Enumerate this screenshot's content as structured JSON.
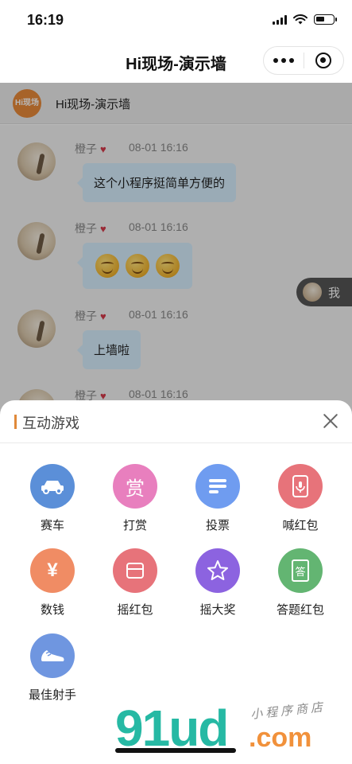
{
  "status_bar": {
    "time": "16:19"
  },
  "nav": {
    "title": "Hi现场-演示墙"
  },
  "page": {
    "logo_text": "Hi现场",
    "header_title": "Hi现场-演示墙",
    "me_label": "我",
    "messages": [
      {
        "sender": "橙子",
        "time": "08-01 16:16",
        "text": "这个小程序挺简单方便的"
      },
      {
        "sender": "橙子",
        "time": "08-01 16:16",
        "emoji_count": 3
      },
      {
        "sender": "橙子",
        "time": "08-01 16:16",
        "text": "上墙啦"
      },
      {
        "sender": "橙子",
        "time": "08-01 16:16"
      }
    ]
  },
  "sheet": {
    "title": "互动游戏",
    "games": [
      {
        "label": "赛车",
        "icon": "car-icon",
        "color": "#5b8fd8"
      },
      {
        "label": "打赏",
        "icon": "reward-icon",
        "glyph": "赏",
        "color": "#e87fbe"
      },
      {
        "label": "投票",
        "icon": "vote-icon",
        "color": "#6f9cf0"
      },
      {
        "label": "喊红包",
        "icon": "voice-redpacket-icon",
        "color": "#e7737a"
      },
      {
        "label": "数钱",
        "icon": "yuan-icon",
        "glyph": "¥",
        "color": "#f08c64"
      },
      {
        "label": "摇红包",
        "icon": "redpacket-icon",
        "color": "#e7737a"
      },
      {
        "label": "摇大奖",
        "icon": "star-icon",
        "color": "#8c63e0"
      },
      {
        "label": "答题红包",
        "icon": "quiz-redpacket-icon",
        "glyph": "答",
        "color": "#63b572"
      },
      {
        "label": "最佳射手",
        "icon": "shoe-icon",
        "color": "#5b8fd8"
      }
    ]
  },
  "watermark": {
    "brand": "91ud",
    "domain": ".com",
    "tagline": "小程序商店"
  }
}
